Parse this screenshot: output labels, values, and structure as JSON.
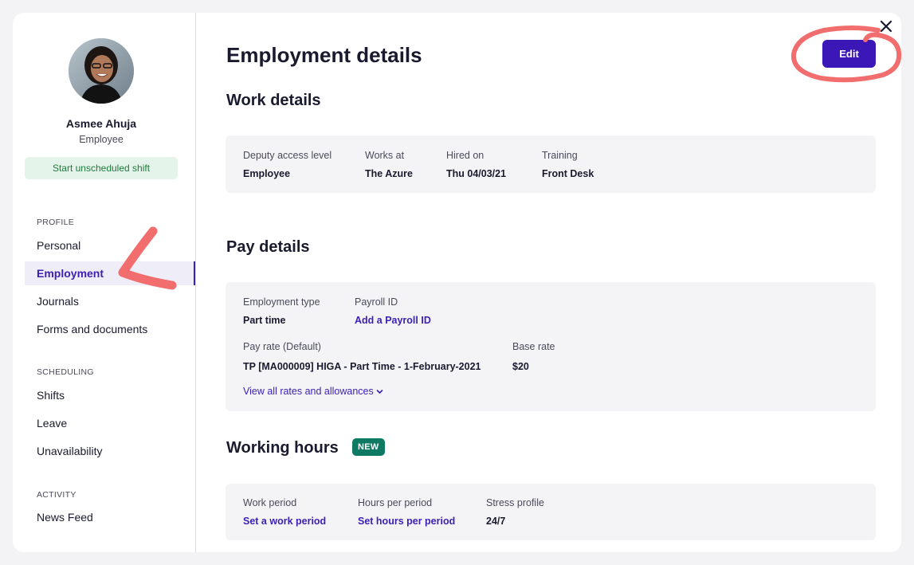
{
  "profile": {
    "name": "Asmee Ahuja",
    "role": "Employee",
    "start_shift_label": "Start unscheduled shift"
  },
  "sidebar": {
    "sections": [
      {
        "heading": "PROFILE",
        "items": [
          "Personal",
          "Employment",
          "Journals",
          "Forms and documents"
        ]
      },
      {
        "heading": "SCHEDULING",
        "items": [
          "Shifts",
          "Leave",
          "Unavailability"
        ]
      },
      {
        "heading": "ACTIVITY",
        "items": [
          "News Feed"
        ]
      }
    ],
    "active_item": "Employment"
  },
  "main": {
    "title": "Employment details",
    "edit_label": "Edit",
    "work_details": {
      "heading": "Work details",
      "fields": [
        {
          "label": "Deputy access level",
          "value": "Employee"
        },
        {
          "label": "Works at",
          "value": "The Azure"
        },
        {
          "label": "Hired on",
          "value": "Thu 04/03/21"
        },
        {
          "label": "Training",
          "value": "Front Desk"
        }
      ]
    },
    "pay_details": {
      "heading": "Pay details",
      "employment_type": {
        "label": "Employment type",
        "value": "Part time"
      },
      "payroll_id": {
        "label": "Payroll ID",
        "value": "Add a Payroll ID"
      },
      "pay_rate": {
        "label": "Pay rate (Default)",
        "value": "TP [MA000009] HIGA - Part Time - 1-February-2021"
      },
      "base_rate": {
        "label": "Base rate",
        "value": "$20"
      },
      "view_rates_label": "View all rates and allowances"
    },
    "working_hours": {
      "heading": "Working hours",
      "badge": "NEW",
      "fields": [
        {
          "label": "Work period",
          "value": "Set a work period"
        },
        {
          "label": "Hours per period",
          "value": "Set hours per period"
        },
        {
          "label": "Stress profile",
          "value": "24/7"
        }
      ]
    }
  },
  "colors": {
    "accent": "#3b17b8",
    "annotation": "#f26d6d",
    "badge": "#0e7a64",
    "shift_button_bg": "#e5f4ea"
  }
}
